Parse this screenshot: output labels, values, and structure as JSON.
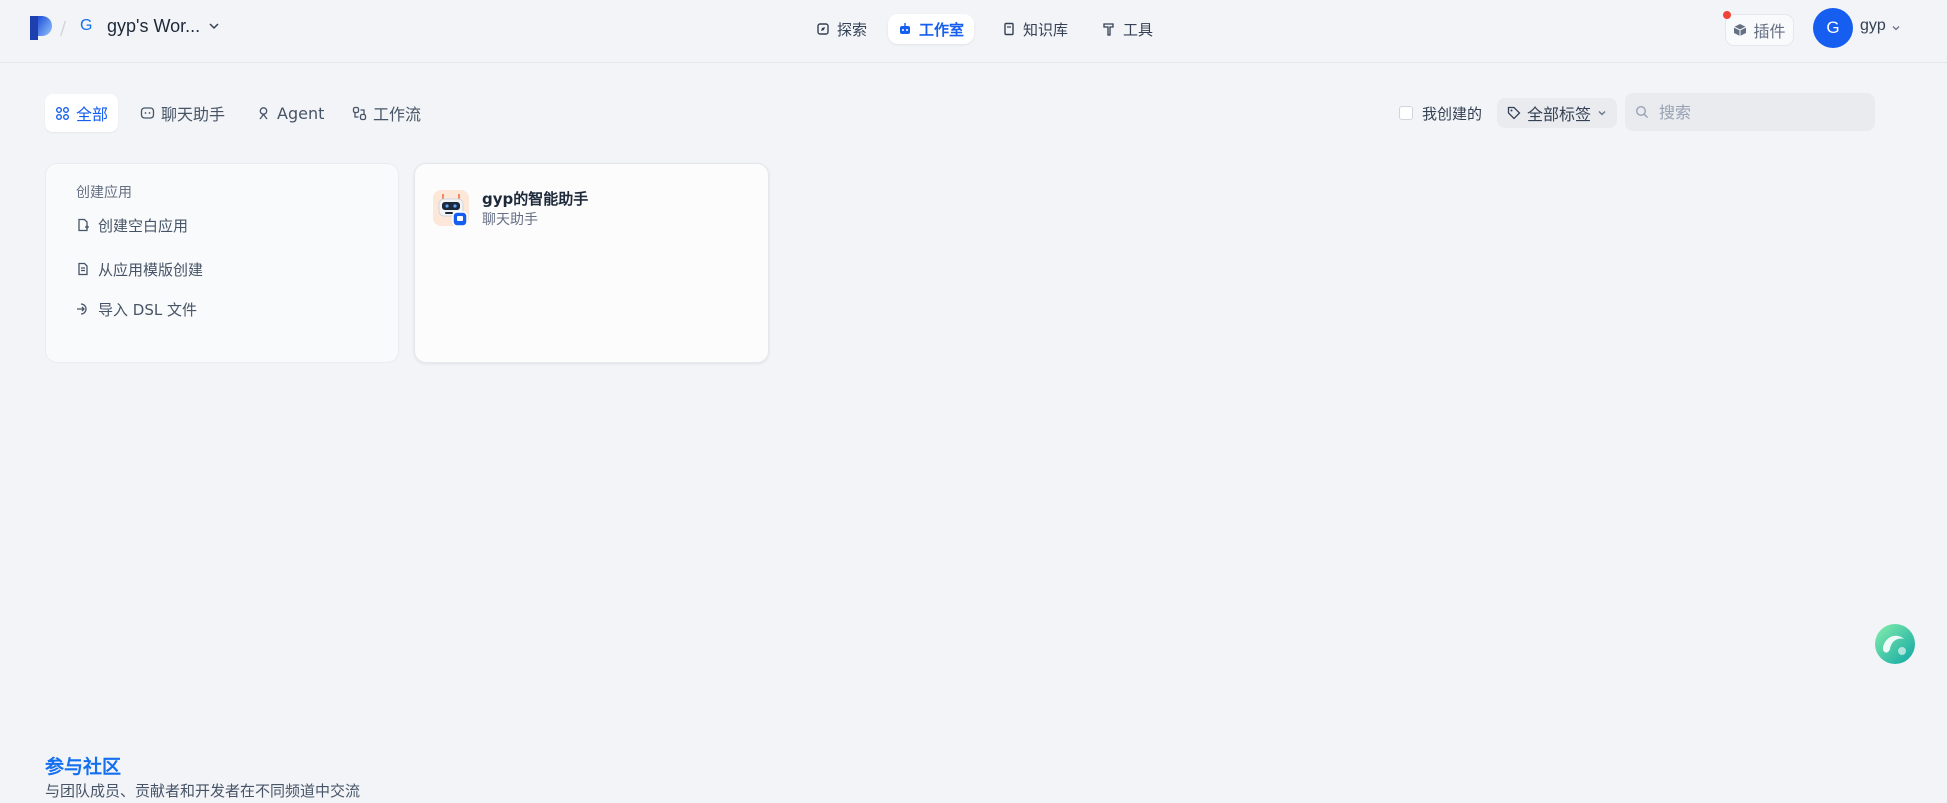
{
  "header": {
    "workspace_badge": "G",
    "workspace_name": "gyp's Wor...",
    "nav": {
      "explore": "探索",
      "studio": "工作室",
      "knowledge": "知识库",
      "tools": "工具"
    },
    "plugins_label": "插件",
    "avatar_initial": "G",
    "user_name": "gyp"
  },
  "filters": {
    "tabs": {
      "all": "全部",
      "chat": "聊天助手",
      "agent": "Agent",
      "workflow": "工作流"
    },
    "mine_label": "我创建的",
    "tag_filter_label": "全部标签",
    "search_placeholder": "搜索"
  },
  "create_card": {
    "title": "创建应用",
    "blank": "创建空白应用",
    "template": "从应用模版创建",
    "dsl": "导入 DSL 文件"
  },
  "apps": [
    {
      "name": "gyp的智能助手",
      "type": "聊天助手"
    }
  ],
  "footer": {
    "community_title": "参与社区",
    "community_desc": "与团队成员、贡献者和开发者在不同频道中交流"
  },
  "colors": {
    "accent": "#155eef",
    "background": "#f2f4f7",
    "notification": "#f04438"
  }
}
